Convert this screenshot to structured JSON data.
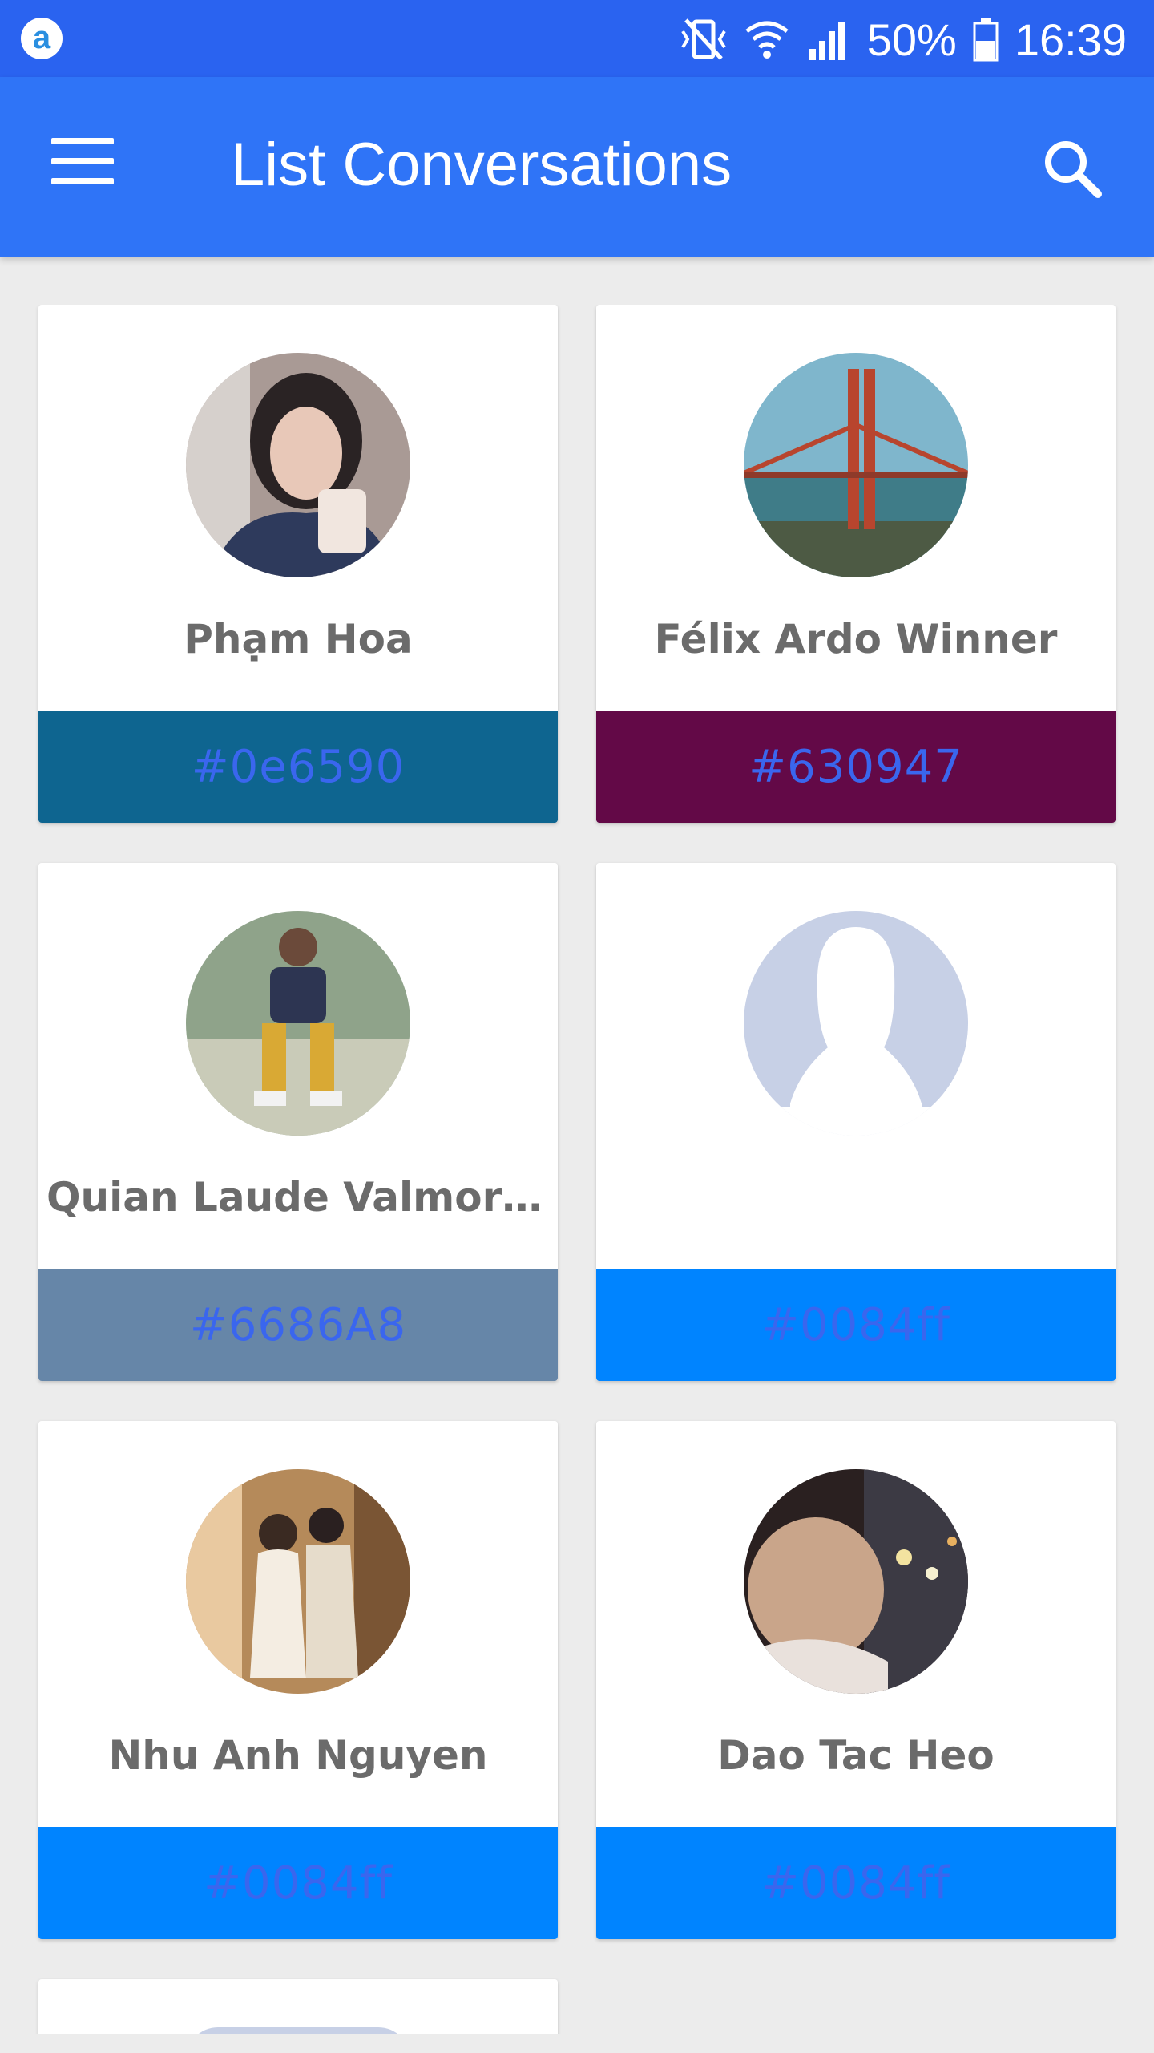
{
  "status_bar": {
    "battery": "50%",
    "time": "16:39",
    "app_badge": "a"
  },
  "app_bar": {
    "title": "List Conversations"
  },
  "conversations": [
    {
      "name": "Phạm Hoa",
      "color": "#0e6590",
      "footer_bg": "#0e6590"
    },
    {
      "name": "Félix Ardo Winner",
      "color": "#630947",
      "footer_bg": "#630947"
    },
    {
      "name": "Quian Laude Valmores...",
      "color": "#6686A8",
      "footer_bg": "#6686A8"
    },
    {
      "name": "",
      "color": "#0084ff",
      "footer_bg": "#0084ff"
    },
    {
      "name": "Nhu Anh Nguyen",
      "color": "#0084ff",
      "footer_bg": "#0084ff"
    },
    {
      "name": "Dao Tac Heo",
      "color": "#0084ff",
      "footer_bg": "#0084ff"
    }
  ],
  "icons": {
    "menu": "hamburger-menu-icon",
    "search": "search-icon",
    "vibrate": "vibrate-icon",
    "wifi": "wifi-icon",
    "signal": "signal-icon",
    "battery": "battery-icon"
  }
}
